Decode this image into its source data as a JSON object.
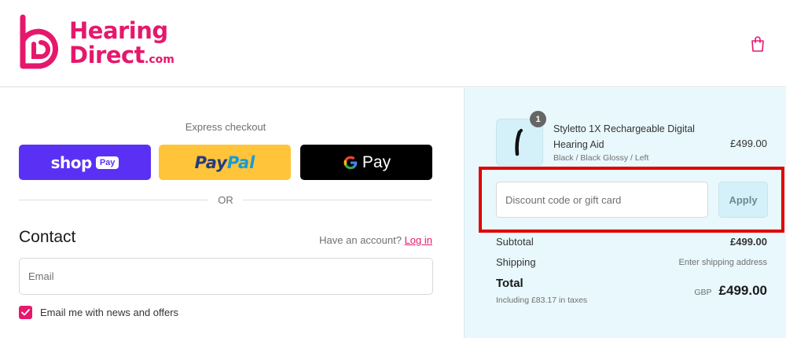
{
  "brand": {
    "line1": "Hearing",
    "line2": "Direct",
    "suffix": ".com",
    "color": "#e5186c"
  },
  "header": {
    "cart_icon": "shopping-bag-icon"
  },
  "express": {
    "label": "Express checkout",
    "shop_pay": {
      "word": "shop",
      "pill": "Pay",
      "color": "#5a31f4"
    },
    "paypal": {
      "part1": "Pay",
      "part2": "Pal",
      "color": "#ffc439"
    },
    "gpay": {
      "word": "Pay",
      "color": "#000000"
    },
    "divider": "OR"
  },
  "contact": {
    "title": "Contact",
    "account_prompt": "Have an account?",
    "login_link": "Log in",
    "email_placeholder": "Email",
    "newsletter_label": "Email me with news and offers",
    "newsletter_checked": true
  },
  "summary": {
    "item": {
      "quantity": "1",
      "name": "Styletto 1X Rechargeable Digital Hearing Aid",
      "variant": "Black / Black Glossy / Left",
      "price": "£499.00"
    },
    "discount_placeholder": "Discount code or gift card",
    "apply_label": "Apply",
    "subtotal_label": "Subtotal",
    "subtotal_value": "£499.00",
    "shipping_label": "Shipping",
    "shipping_value": "Enter shipping address",
    "total_label": "Total",
    "tax_note": "Including £83.17 in taxes",
    "currency": "GBP",
    "total_value": "£499.00",
    "highlight_color": "#e00000"
  }
}
